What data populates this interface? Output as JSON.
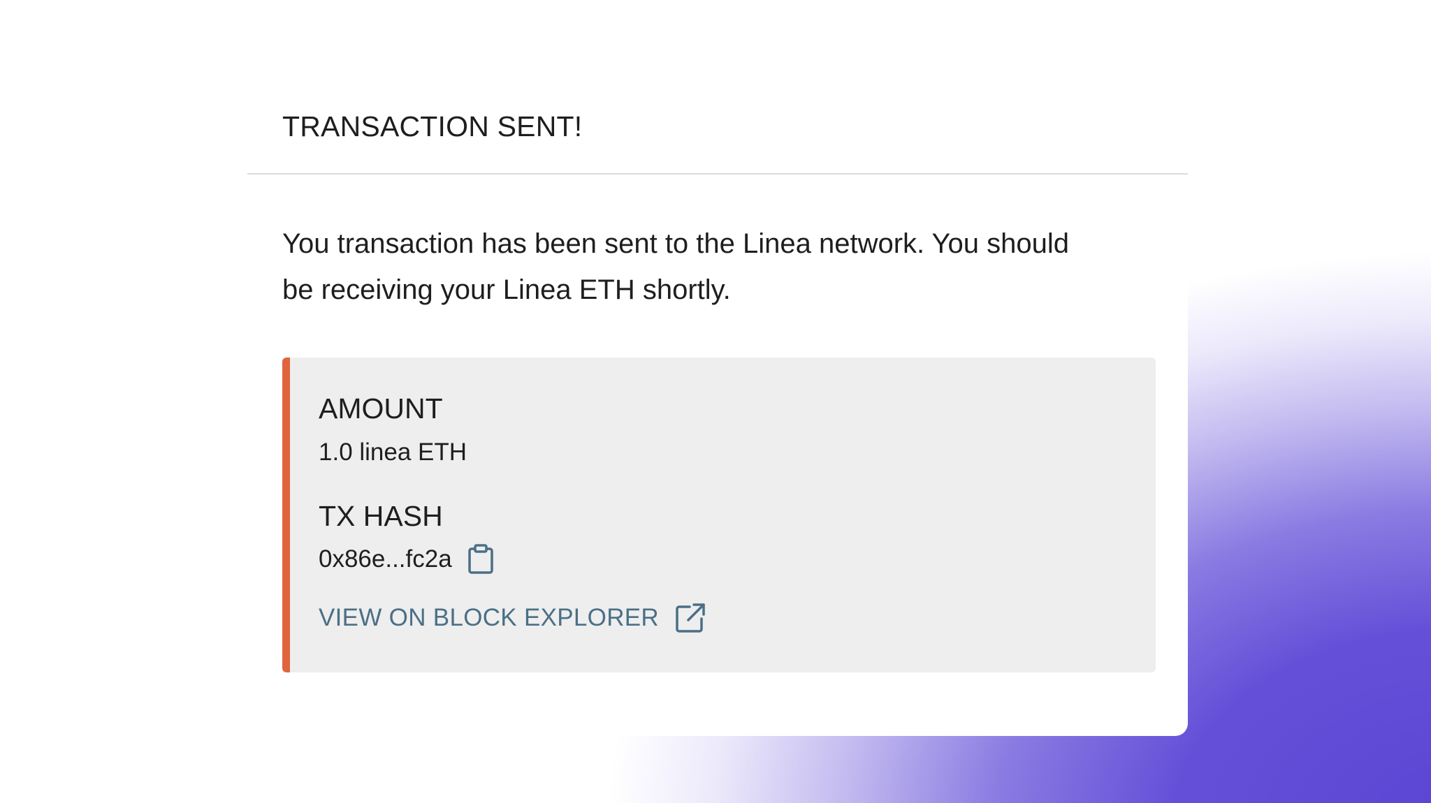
{
  "modal": {
    "title": "TRANSACTION SENT!",
    "message": "You transaction has been sent to the Linea network. You should be receiving your Linea ETH shortly."
  },
  "details": {
    "amount_label": "AMOUNT",
    "amount_value": "1.0 linea ETH",
    "tx_hash_label": "TX HASH",
    "tx_hash_value": "0x86e...fc2a",
    "copy_icon": "clipboard-icon",
    "explorer_link_label": "VIEW ON BLOCK EXPLORER",
    "explorer_icon": "external-link-icon"
  },
  "colors": {
    "accent_border": "#e0653d",
    "link": "#4b6f86",
    "card_background": "#eeeeee",
    "gradient": "#5a45d3"
  }
}
